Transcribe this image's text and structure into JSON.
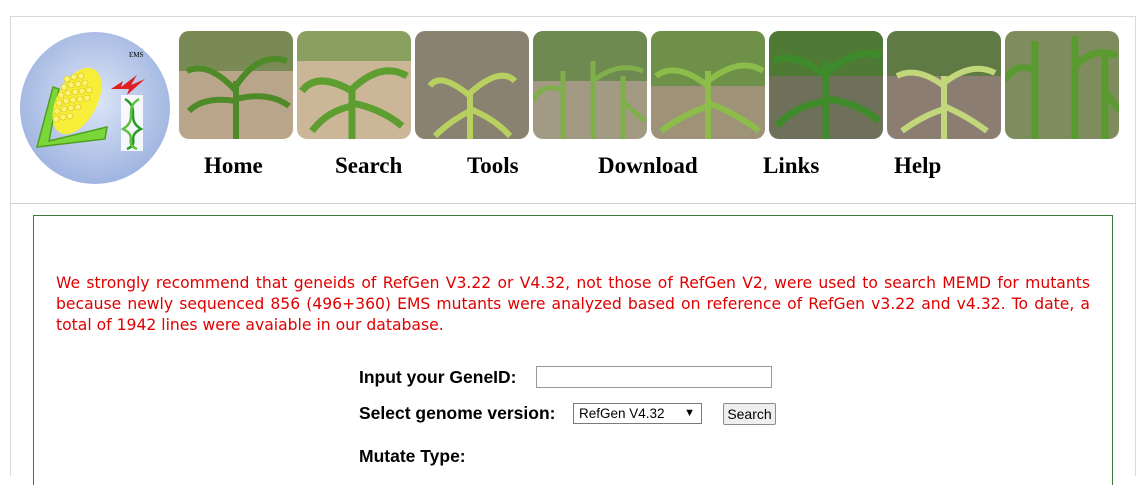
{
  "logo": {
    "badge": "EMS"
  },
  "nav": {
    "items": [
      {
        "label": "Home"
      },
      {
        "label": "Search"
      },
      {
        "label": "Tools"
      },
      {
        "label": "Download"
      },
      {
        "label": "Links"
      },
      {
        "label": "Help"
      }
    ]
  },
  "notice": "We strongly recommend that geneids of RefGen V3.22 or V4.32, not those of RefGen V2, were used to search MEMD for mutants because newly sequenced 856 (496+360) EMS mutants were analyzed based on reference of RefGen v3.22 and v4.32. To date, a total of 1942 lines were avaiable in our database.",
  "form": {
    "gene_label": "Input your GeneID:",
    "gene_value": "",
    "genome_label": "Select genome version:",
    "genome_selected": "RefGen V4.32",
    "search_button": "Search",
    "mutate_label": "Mutate Type:"
  },
  "colors": {
    "notice": "#e00000",
    "panel_border": "#3b7a3b"
  }
}
